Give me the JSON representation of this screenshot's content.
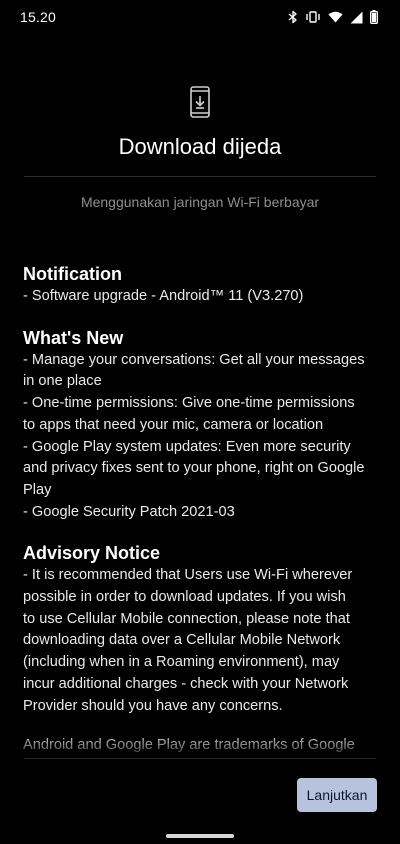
{
  "status_bar": {
    "time": "15.20",
    "icons": [
      "bluetooth-icon",
      "vibrate-icon",
      "wifi-icon",
      "cellular-icon",
      "battery-icon"
    ]
  },
  "header": {
    "icon": "phone-download-icon",
    "title": "Download dijeda",
    "subtitle": "Menggunakan jaringan Wi-Fi berbayar"
  },
  "sections": [
    {
      "heading": "Notification",
      "lines": [
        "- Software upgrade - Android™ 11 (V3.270)"
      ]
    },
    {
      "heading": "What's New",
      "lines": [
        "- Manage your conversations: Get all your messages",
        "in one place",
        "- One-time permissions: Give one-time permissions",
        "to apps that need your mic, camera or location",
        "- Google Play system updates: Even more security",
        "and privacy fixes sent to your phone, right on Google",
        "Play",
        "- Google Security Patch 2021-03"
      ]
    },
    {
      "heading": "Advisory Notice",
      "lines": [
        "- It is recommended that Users use Wi-Fi wherever",
        "possible in order to download updates. If you wish",
        "to use Cellular Mobile connection, please note that",
        "downloading data over a Cellular Mobile Network",
        "(including when in a Roaming environment), may",
        "incur additional charges - check with your Network",
        "Provider should you have any concerns."
      ]
    }
  ],
  "cut_off_line": "Android and Google Play are trademarks of Google",
  "actions": {
    "continue_label": "Lanjutkan"
  },
  "colors": {
    "background": "#000000",
    "button": "#b7c3dc"
  }
}
